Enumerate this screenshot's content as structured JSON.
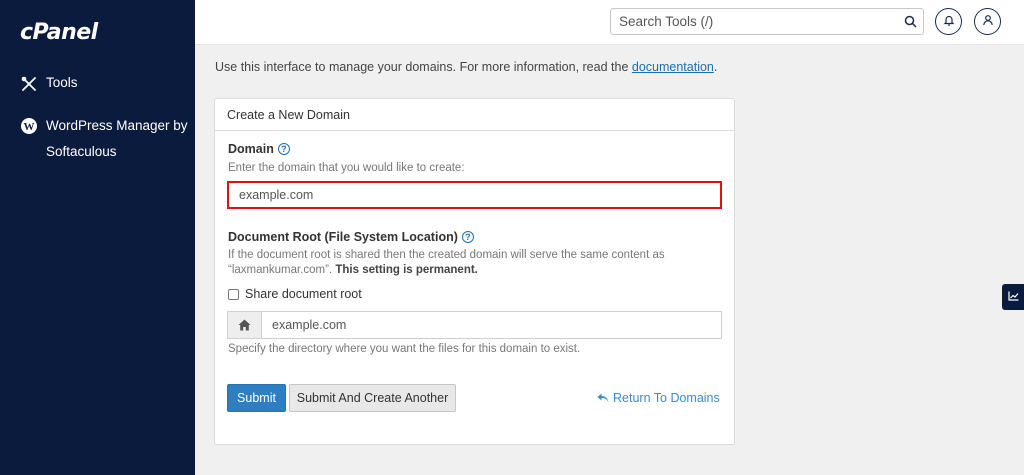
{
  "sidebar": {
    "logo": "cPanel",
    "items": [
      {
        "label": "Tools",
        "icon": "tools-icon"
      },
      {
        "label": "WordPress Manager by Softaculous",
        "icon": "wordpress-icon"
      }
    ]
  },
  "header": {
    "search_placeholder": "Search Tools (/)",
    "icons": [
      "search-icon",
      "bell-icon",
      "user-icon"
    ]
  },
  "intro": {
    "text": "Use this interface to manage your domains. For more information, read the ",
    "link": "documentation",
    "suffix": "."
  },
  "panel": {
    "title": "Create a New Domain",
    "domain": {
      "label": "Domain",
      "hint": "Enter the domain that you would like to create:",
      "value": "example.com"
    },
    "docroot": {
      "label": "Document Root (File System Location)",
      "hint_line1": "If the document root is shared then the created domain will serve the same content as",
      "hint_line2": "“laxmankumar.com”.",
      "hint_bold": "This setting is permanent.",
      "share_label": "Share document root",
      "share_checked": false,
      "value": "example.com",
      "value_hint": "Specify the directory where you want the files for this domain to exist."
    },
    "buttons": {
      "submit": "Submit",
      "submit_another": "Submit And Create Another",
      "return": "Return To Domains"
    }
  },
  "colors": {
    "sidebar_bg": "#0b1b3e",
    "accent": "#2d7fc2",
    "highlight_border": "#e0101a"
  }
}
